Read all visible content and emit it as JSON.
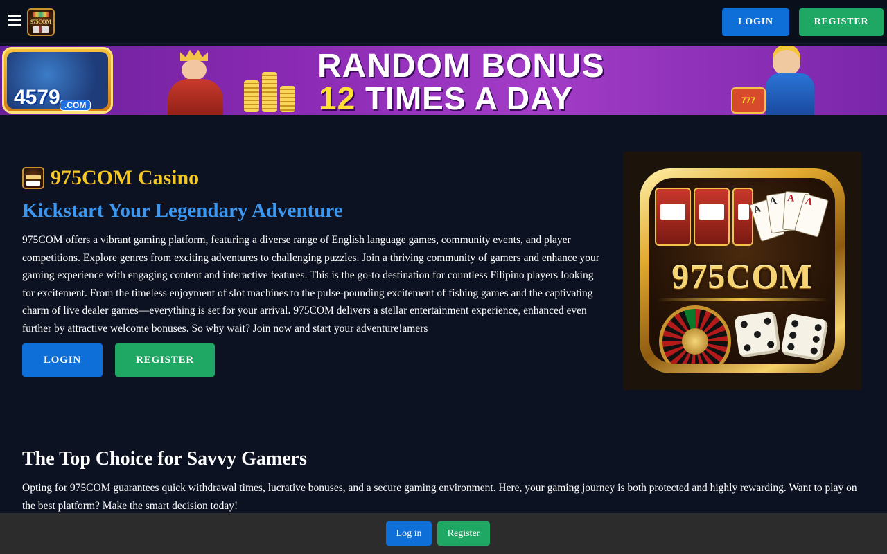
{
  "header": {
    "logo_text": "975COM",
    "login_label": "LOGIN",
    "register_label": "REGISTER"
  },
  "banner": {
    "brand": "4579",
    "brand_sub": ".COM",
    "headline_line1": "RANDOM BONUS",
    "headline_number": "12",
    "headline_line2_rest": " TIMES A DAY",
    "slot_text": "777"
  },
  "hero": {
    "title": "975COM Casino",
    "subtitle": "Kickstart Your Legendary Adventure",
    "body": "975COM offers a vibrant gaming platform, featuring a diverse range of English language games, community events, and player competitions. Explore genres from exciting adventures to challenging puzzles. Join a thriving community of gamers and enhance your gaming experience with engaging content and interactive features. This is the go-to destination for countless Filipino players looking for excitement. From the timeless enjoyment of slot machines to the pulse-pounding excitement of fishing games and the captivating charm of live dealer games—everything is set for your arrival. 975COM delivers a stellar entertainment experience, enhanced even further by attractive welcome bonuses. So why wait? Join now and start your adventure!amers",
    "login_label": "LOGIN",
    "register_label": "REGISTER",
    "image_label": "975COM",
    "cards": [
      "A",
      "A",
      "A",
      "A"
    ]
  },
  "section2": {
    "title": "The Top Choice for Savvy Gamers",
    "body": "Opting for 975COM guarantees quick withdrawal times, lucrative bonuses, and a secure gaming environment. Here, your gaming journey is both protected and highly rewarding. Want to play on the best platform? Make the smart decision today!"
  },
  "bottom_bar": {
    "login_label": "Log in",
    "register_label": "Register"
  },
  "colors": {
    "page_bg": "#0c1222",
    "header_bg": "#0a0f1c",
    "login_blue": "#0e6fd9",
    "register_green": "#1fa764",
    "title_gold": "#f5c722",
    "subtitle_blue": "#3b97f0",
    "bottom_bar_bg": "#2c2c2c"
  },
  "icons": {
    "menu": "hamburger-menu-icon"
  }
}
